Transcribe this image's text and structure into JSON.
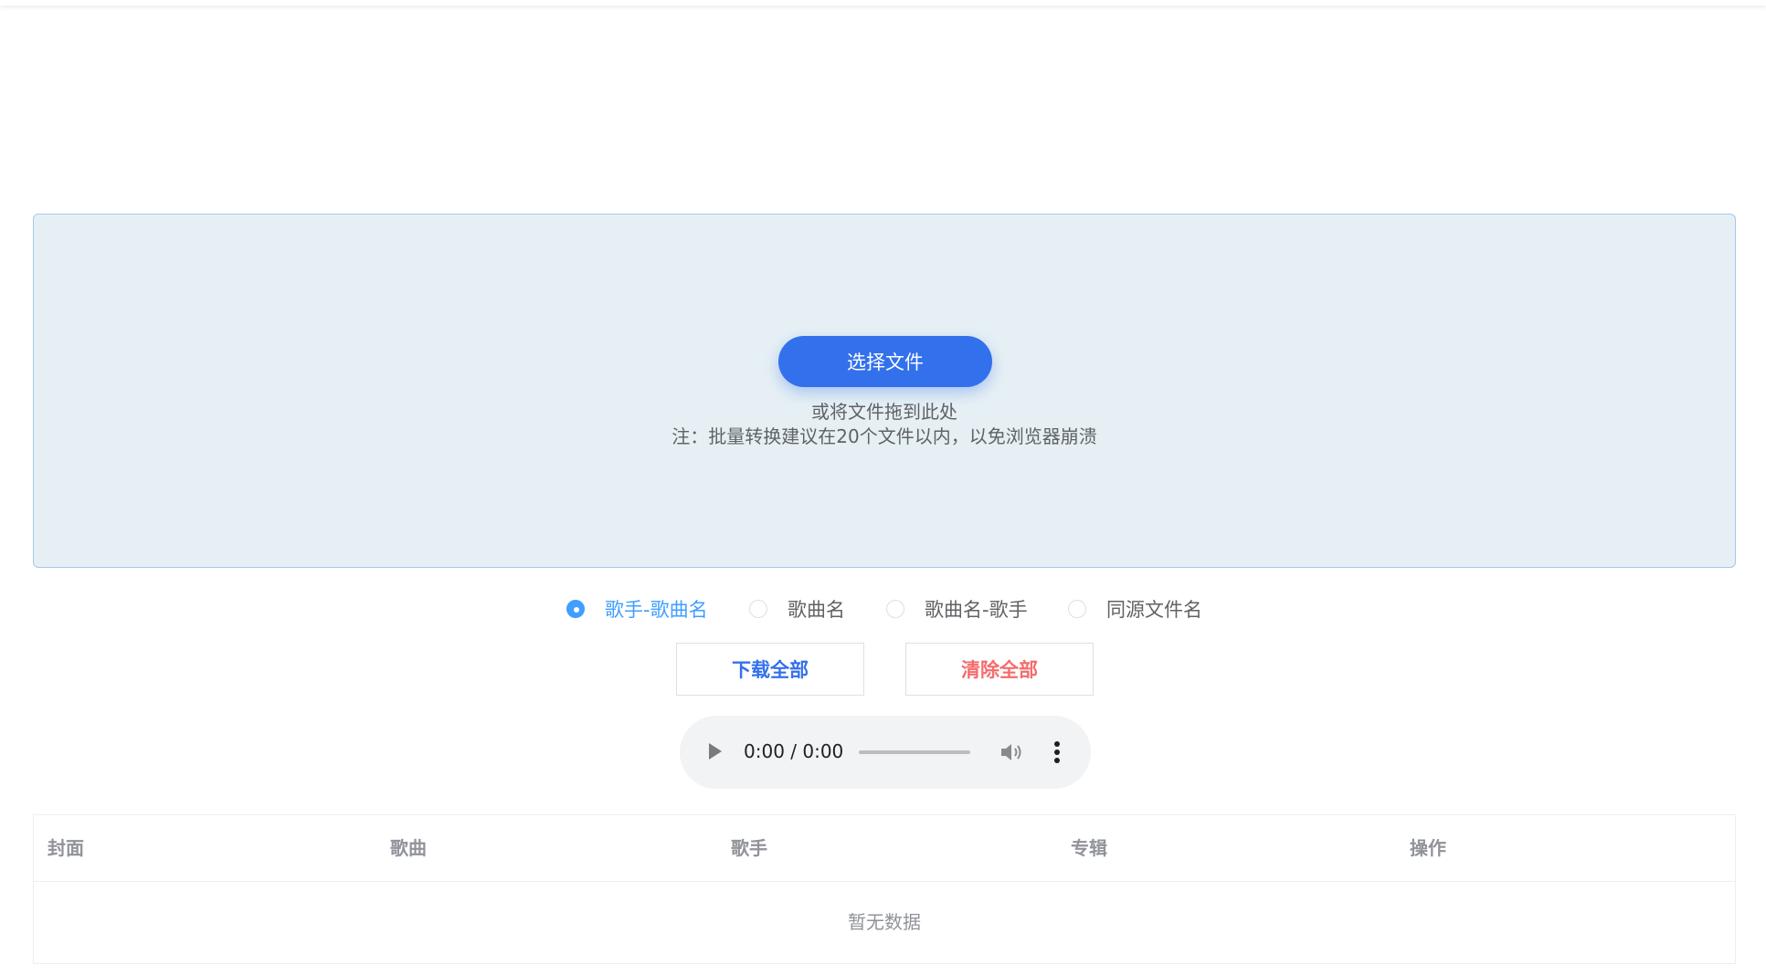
{
  "upload": {
    "select_button": "选择文件",
    "drop_hint": "或将文件拖到此处",
    "note": "注：批量转换建议在20个文件以内，以免浏览器崩溃"
  },
  "naming_options": [
    {
      "label": "歌手-歌曲名",
      "checked": true
    },
    {
      "label": "歌曲名",
      "checked": false
    },
    {
      "label": "歌曲名-歌手",
      "checked": false
    },
    {
      "label": "同源文件名",
      "checked": false
    }
  ],
  "actions": {
    "download_all": "下载全部",
    "clear_all": "清除全部"
  },
  "player": {
    "time": "0:00 / 0:00"
  },
  "table": {
    "columns": [
      "封面",
      "歌曲",
      "歌手",
      "专辑",
      "操作"
    ],
    "empty_text": "暂无数据"
  },
  "colors": {
    "primary": "#3370ec",
    "radio_active": "#409eff",
    "danger": "#f56c6c"
  }
}
